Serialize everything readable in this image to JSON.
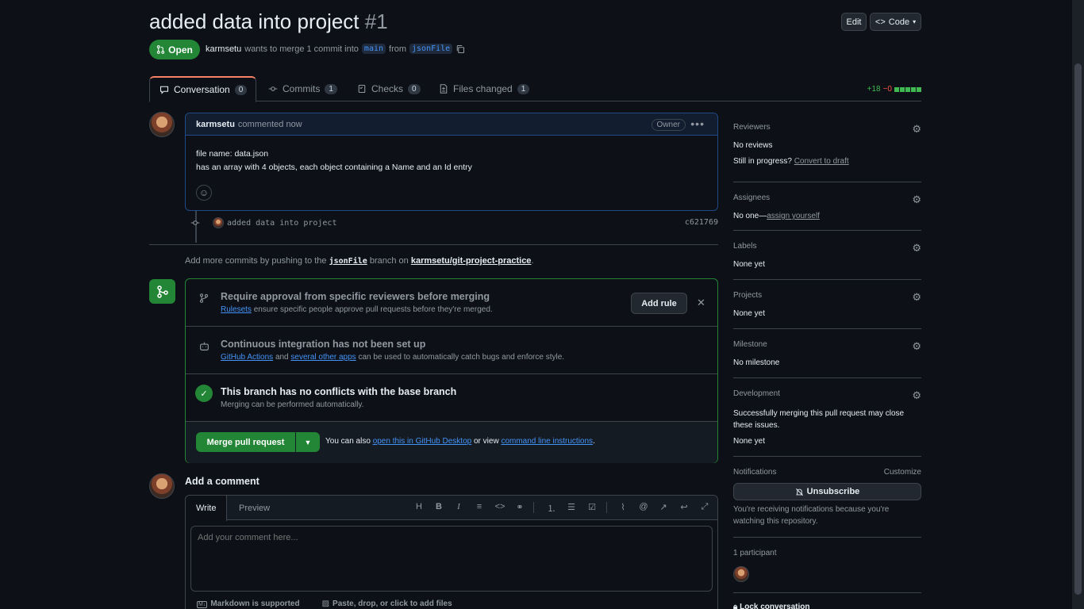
{
  "header": {
    "title": "added data into project",
    "number": "#1",
    "edit_label": "Edit",
    "code_label": "Code",
    "state": "Open",
    "author": "karmsetu",
    "merge_text": "wants to merge 1 commit into",
    "base_branch": "main",
    "from_text": "from",
    "head_branch": "jsonFile"
  },
  "tabs": [
    {
      "label": "Conversation",
      "count": "0"
    },
    {
      "label": "Commits",
      "count": "1"
    },
    {
      "label": "Checks",
      "count": "0"
    },
    {
      "label": "Files changed",
      "count": "1"
    }
  ],
  "diffstat": {
    "additions": "+18",
    "deletions": "−0"
  },
  "comment": {
    "author": "karmsetu",
    "action": "commented now",
    "badge": "Owner",
    "line1": "file name: data.json",
    "line2": "has an array with 4 objects, each object containing a Name and an Id entry"
  },
  "commit": {
    "message": "added data into project",
    "sha": "c621769"
  },
  "push_hint": {
    "prefix": "Add more commits by pushing to the",
    "branch": "jsonFile",
    "middle": "branch on",
    "repo": "karmsetu/git-project-practice",
    "suffix": "."
  },
  "merge": {
    "rule_title": "Require approval from specific reviewers before merging",
    "rule_link": "Rulesets",
    "rule_sub": "ensure specific people approve pull requests before they're merged.",
    "add_rule": "Add rule",
    "ci_title": "Continuous integration has not been set up",
    "ci_link1": "GitHub Actions",
    "ci_and": "and",
    "ci_link2": "several other apps",
    "ci_sub": "can be used to automatically catch bugs and enforce style.",
    "conflict_title": "This branch has no conflicts with the base branch",
    "conflict_sub": "Merging can be performed automatically.",
    "merge_button": "Merge pull request",
    "alt_prefix": "You can also",
    "alt_link1": "open this in GitHub Desktop",
    "alt_or": "or view",
    "alt_link2": "command line instructions",
    "alt_suffix": "."
  },
  "add_comment": {
    "title": "Add a comment",
    "write_tab": "Write",
    "preview_tab": "Preview",
    "placeholder": "Add your comment here...",
    "markdown_note": "Markdown is supported",
    "attach_note": "Paste, drop, or click to add files"
  },
  "sidebar": {
    "reviewers_label": "Reviewers",
    "reviewers_value": "No reviews",
    "wip_text": "Still in progress?",
    "wip_link": "Convert to draft",
    "assignees_label": "Assignees",
    "assignees_value": "No one—",
    "assignees_link": "assign yourself",
    "labels_label": "Labels",
    "labels_value": "None yet",
    "projects_label": "Projects",
    "projects_value": "None yet",
    "milestone_label": "Milestone",
    "milestone_value": "No milestone",
    "development_label": "Development",
    "development_text": "Successfully merging this pull request may close these issues.",
    "development_value": "None yet",
    "notifications_label": "Notifications",
    "customize_link": "Customize",
    "unsubscribe_label": "Unsubscribe",
    "notifications_reason": "You're receiving notifications because you're watching this repository.",
    "participants_label": "1 participant",
    "lock_label": "Lock conversation"
  },
  "colors": {
    "accent_green": "#238636",
    "link_blue": "#4493f8",
    "bg": "#0d1117"
  }
}
